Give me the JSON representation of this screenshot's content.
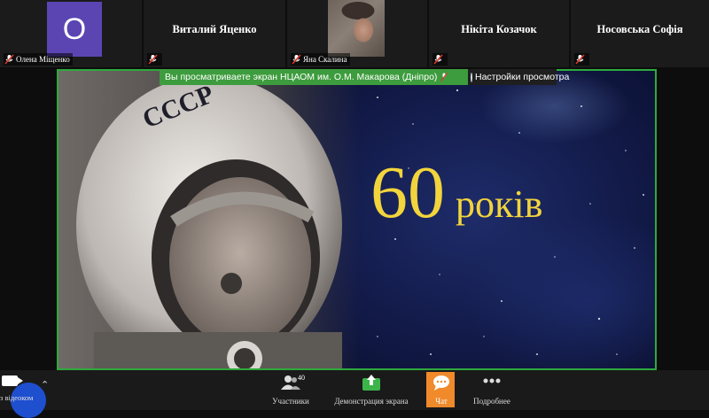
{
  "participants": [
    {
      "display": "O",
      "name": "Олена Міщенко"
    },
    {
      "display": "Виталий Яценко"
    },
    {
      "display": "",
      "name": "Яна Скалина"
    },
    {
      "display": "Нікіта Козачок"
    },
    {
      "display": "Носовська Софія"
    }
  ],
  "share_banner": {
    "text": "Вы просматриваете экран НЦАОМ им. О.М. Макарова (Дніпро)",
    "settings": "Настройки просмотра"
  },
  "slide": {
    "number": "60",
    "word": "років",
    "helmet_text": "CCCP",
    "number_color": "#f2d43c"
  },
  "toolbar": {
    "video_label": "з відеоком",
    "participants_label": "Участники",
    "participants_count": "40",
    "share_label": "Демонстрация экрана",
    "chat_label": "Чат",
    "more_label": "Подробнее"
  },
  "colors": {
    "share_border": "#2eaa3e",
    "banner_bg": "#3d9c3d",
    "chat_bg": "#f08a2b",
    "avatar_bg": "#5b45b3",
    "mic_off": "#e0352b"
  }
}
